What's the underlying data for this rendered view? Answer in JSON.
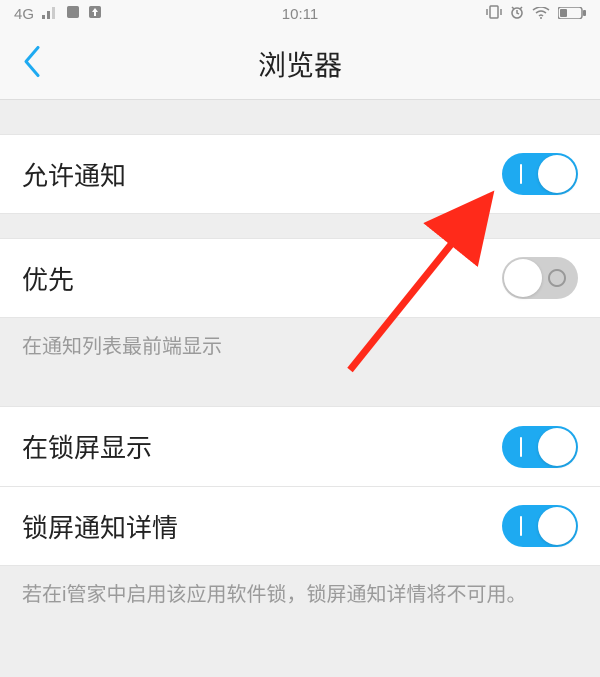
{
  "statusBar": {
    "network": "4G",
    "time": "10:11"
  },
  "nav": {
    "title": "浏览器"
  },
  "rows": {
    "allowNotify": {
      "label": "允许通知",
      "on": true
    },
    "priority": {
      "label": "优先",
      "on": false,
      "desc": "在通知列表最前端显示"
    },
    "lockScreen": {
      "label": "在锁屏显示",
      "on": true
    },
    "lockDetail": {
      "label": "锁屏通知详情",
      "on": true,
      "desc": "若在i管家中启用该应用软件锁，锁屏通知详情将不可用。"
    }
  }
}
